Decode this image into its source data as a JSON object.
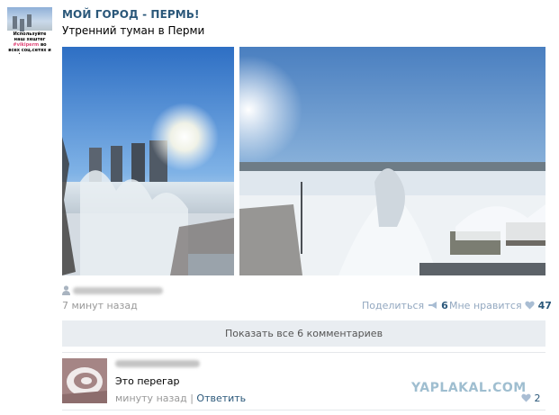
{
  "group": {
    "avatar_text_1": "Используйте наш хештег",
    "avatar_hashtag": "#vikiperm",
    "avatar_text_2": "во всех соц.сетях и форумах. Спасибо!",
    "name": "МОЙ ГОРОД - ПЕРМЬ!"
  },
  "post": {
    "text": "Утренний туман в Перми",
    "time": "7 минут назад",
    "share_label": "Поделиться",
    "share_count": "6",
    "like_label": "Мне нравится",
    "like_count": "47"
  },
  "comments": {
    "show_all_label": "Показать все 6 комментариев",
    "items": [
      {
        "text": "Это перегар",
        "time": "минуту назад",
        "reply_label": "Ответить",
        "like_count": "2"
      }
    ]
  },
  "watermark": "YAPLAKAL.COM",
  "colors": {
    "link": "#2b587a",
    "muted": "#999999",
    "bar": "#e9edf1"
  }
}
